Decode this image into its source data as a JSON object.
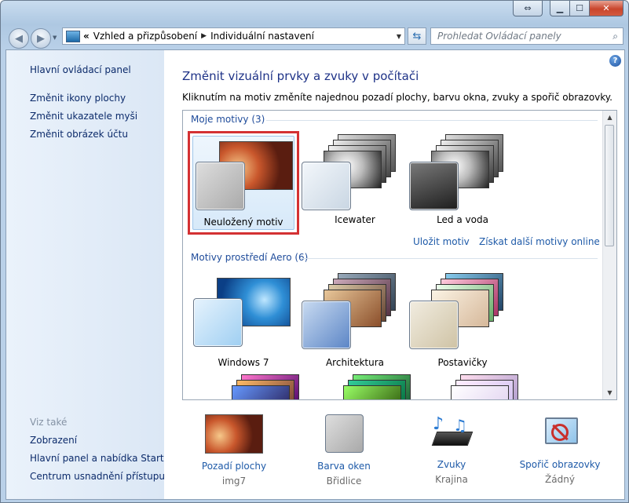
{
  "window": {
    "caption_buttons": {
      "restore": "⇔",
      "minimize": "▁",
      "maximize": "☐",
      "close": "✕"
    }
  },
  "nav": {
    "back_icon": "◀",
    "forward_icon": "▶",
    "address": {
      "prefix": "«",
      "crumbs": [
        "Vzhled a přizpůsobení",
        "Individuální nastavení"
      ],
      "separator": "▶"
    },
    "refresh_icon": "⇆",
    "search_placeholder": "Prohledat Ovládací panely",
    "search_icon": "⌕"
  },
  "sidebar": {
    "home": "Hlavní ovládací panel",
    "links": [
      "Změnit ikony plochy",
      "Změnit ukazatele myši",
      "Změnit obrázek účtu"
    ],
    "see_also_title": "Viz také",
    "see_also": [
      "Zobrazení",
      "Hlavní panel a nabídka Start",
      "Centrum usnadnění přístupu"
    ]
  },
  "main": {
    "title": "Změnit vizuální prvky a zvuky v počítači",
    "subtitle": "Kliknutím na motiv změníte najednou pozadí plochy, barvu okna, zvuky a spořič obrazovky.",
    "my_themes_title": "Moje motivy (3)",
    "my_themes": [
      {
        "name": "Neuložený motiv",
        "selected": true
      },
      {
        "name": "Icewater",
        "selected": false
      },
      {
        "name": "Led a voda",
        "selected": false
      }
    ],
    "save_theme_link": "Uložit motiv",
    "more_themes_link": "Získat další motivy online",
    "aero_title": "Motivy prostředí Aero (6)",
    "aero_themes": [
      {
        "name": "Windows 7"
      },
      {
        "name": "Architektura"
      },
      {
        "name": "Postavičky"
      }
    ],
    "help_icon": "?"
  },
  "bottom": [
    {
      "title": "Pozadí plochy",
      "value": "img7"
    },
    {
      "title": "Barva oken",
      "value": "Břidlice"
    },
    {
      "title": "Zvuky",
      "value": "Krajina"
    },
    {
      "title": "Spořič obrazovky",
      "value": "Žádný"
    }
  ]
}
